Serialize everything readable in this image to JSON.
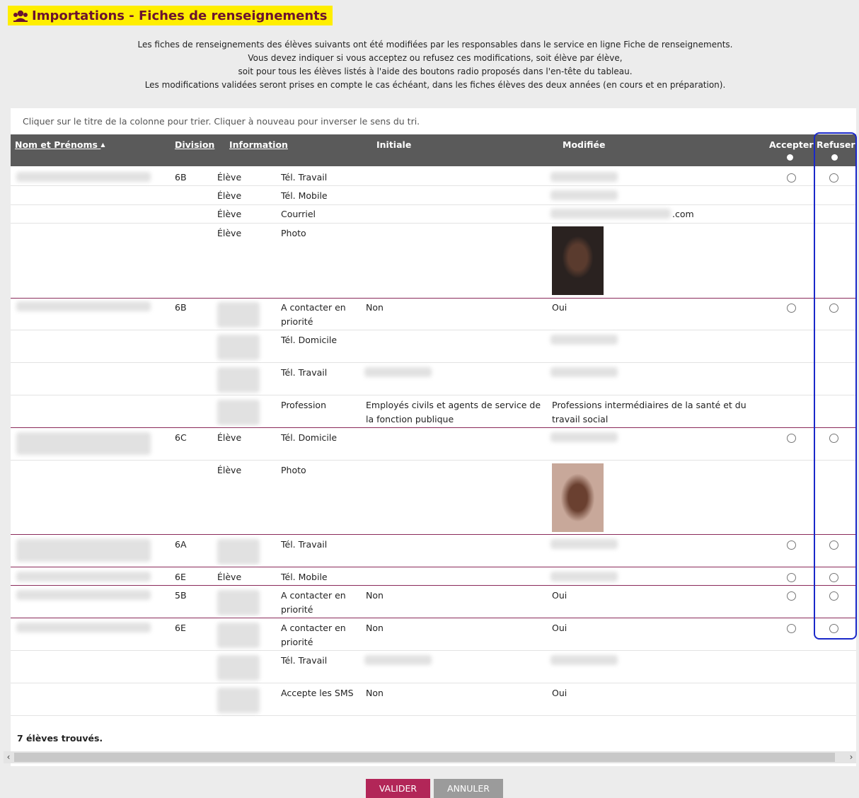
{
  "title": "Importations - Fiches de renseignements",
  "intro": [
    "Les fiches de renseignements des élèves suivants ont été modifiées par les responsables dans le service en ligne Fiche de renseignements.",
    "Vous devez indiquer si vous acceptez ou refusez ces modifications, soit élève par élève,",
    "soit pour tous les élèves listés à l'aide des boutons radio proposés dans l'en-tête du tableau.",
    "Les modifications validées seront prises en compte le cas échéant, dans les fiches élèves des deux années (en cours et en préparation)."
  ],
  "hint": "Cliquer sur le titre de la colonne pour trier. Cliquer à nouveau pour inverser le sens du tri.",
  "columns": {
    "name": "Nom et Prénoms",
    "sort_arrow": "▲",
    "division": "Division",
    "information": "Information",
    "initiale": "Initiale",
    "modifiee": "Modifiée",
    "accepter": "Accepter",
    "refuser": "Refuser"
  },
  "rows": [
    {
      "division": "6B",
      "who": "Élève",
      "info": "Tél. Travail",
      "initiale": "",
      "modifiee": ""
    },
    {
      "division": "",
      "who": "Élève",
      "info": "Tél. Mobile",
      "initiale": "",
      "modifiee": ""
    },
    {
      "division": "",
      "who": "Élève",
      "info": "Courriel",
      "initiale": "",
      "modifiee": ".com"
    },
    {
      "division": "",
      "who": "Élève",
      "info": "Photo",
      "initiale": "",
      "modifiee": ""
    },
    {
      "division": "6B",
      "who": "",
      "info": "A contacter en priorité",
      "initiale": "Non",
      "modifiee": "Oui"
    },
    {
      "division": "",
      "who": "",
      "info": "Tél. Domicile",
      "initiale": "",
      "modifiee": ""
    },
    {
      "division": "",
      "who": "",
      "info": "Tél. Travail",
      "initiale": "",
      "modifiee": ""
    },
    {
      "division": "",
      "who": "",
      "info": "Profession",
      "initiale": "Employés civils et agents de service de la fonction publique",
      "modifiee": "Professions intermédiaires de la santé et du travail social"
    },
    {
      "division": "6C",
      "who": "Élève",
      "info": "Tél. Domicile",
      "initiale": "",
      "modifiee": ""
    },
    {
      "division": "",
      "who": "Élève",
      "info": "Photo",
      "initiale": "",
      "modifiee": ""
    },
    {
      "division": "6A",
      "who": "",
      "info": "Tél. Travail",
      "initiale": "",
      "modifiee": ""
    },
    {
      "division": "6E",
      "who": "Élève",
      "info": "Tél. Mobile",
      "initiale": "",
      "modifiee": ""
    },
    {
      "division": "5B",
      "who": "",
      "info": "A contacter en priorité",
      "initiale": "Non",
      "modifiee": "Oui"
    },
    {
      "division": "6E",
      "who": "",
      "info": "A contacter en priorité",
      "initiale": "Non",
      "modifiee": "Oui"
    },
    {
      "division": "",
      "who": "",
      "info": "Tél. Travail",
      "initiale": "",
      "modifiee": ""
    },
    {
      "division": "",
      "who": "",
      "info": "Accepte les SMS",
      "initiale": "Non",
      "modifiee": "Oui"
    }
  ],
  "count": "7 élèves trouvés.",
  "buttons": {
    "valider": "VALIDER",
    "annuler": "ANNULER"
  },
  "colors": {
    "accent": "#b22658",
    "title_bg": "#ffee00",
    "header_bg": "#5a5a5a",
    "highlight": "#1a28c9"
  }
}
